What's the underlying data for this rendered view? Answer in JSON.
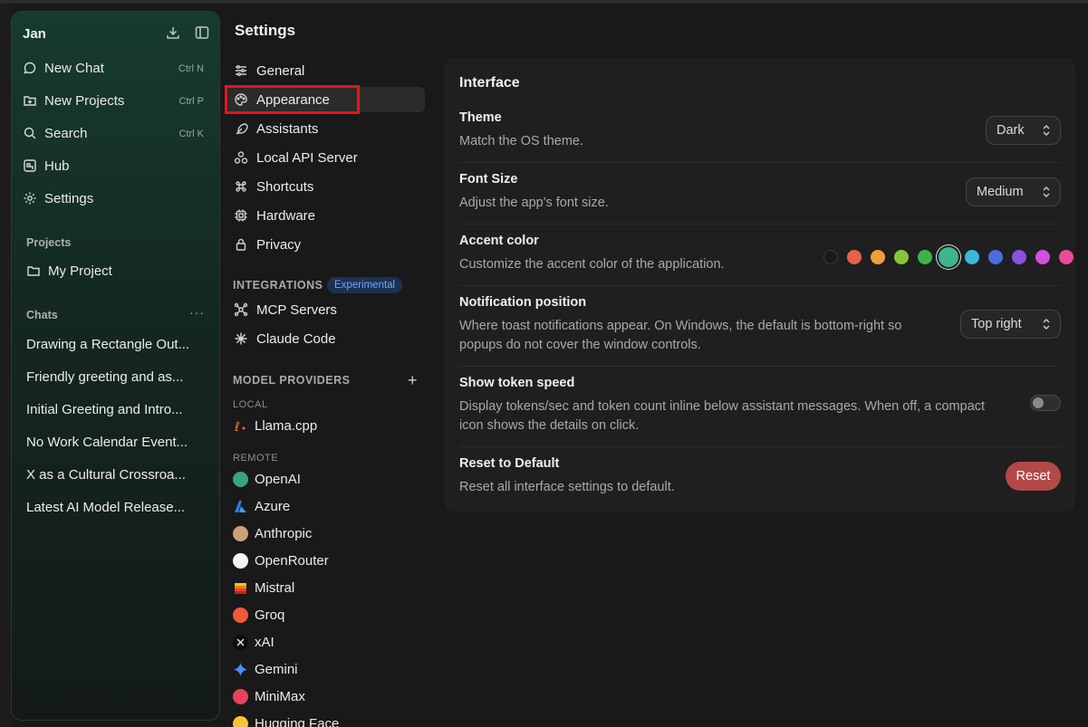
{
  "sidebar": {
    "title": "Jan",
    "nav": [
      {
        "label": "New Chat",
        "shortcut": "Ctrl N",
        "icon": "chat-bubble-icon"
      },
      {
        "label": "New Projects",
        "shortcut": "Ctrl P",
        "icon": "folder-plus-icon"
      },
      {
        "label": "Search",
        "shortcut": "Ctrl K",
        "icon": "search-icon"
      },
      {
        "label": "Hub",
        "shortcut": "",
        "icon": "hub-icon"
      },
      {
        "label": "Settings",
        "shortcut": "",
        "icon": "gear-icon"
      }
    ],
    "projects_label": "Projects",
    "projects": [
      {
        "label": "My Project",
        "icon": "folder-icon"
      }
    ],
    "chats_label": "Chats",
    "chats_more": "···",
    "chats": [
      "Drawing a Rectangle Out...",
      "Friendly greeting and as...",
      "Initial Greeting and Intro...",
      "No Work Calendar Event...",
      "X as a Cultural Crossroa...",
      "Latest AI Model Release..."
    ]
  },
  "settings": {
    "title": "Settings",
    "menu": [
      {
        "label": "General",
        "icon": "sliders-icon"
      },
      {
        "label": "Appearance",
        "icon": "palette-icon",
        "active": true
      },
      {
        "label": "Assistants",
        "icon": "feather-icon"
      },
      {
        "label": "Local API Server",
        "icon": "server-icon"
      },
      {
        "label": "Shortcuts",
        "icon": "command-icon"
      },
      {
        "label": "Hardware",
        "icon": "cpu-icon"
      },
      {
        "label": "Privacy",
        "icon": "lock-icon"
      }
    ],
    "integrations_label": "INTEGRATIONS",
    "experimental_badge": "Experimental",
    "integrations": [
      {
        "label": "MCP Servers",
        "icon": "mcp-icon"
      },
      {
        "label": "Claude Code",
        "icon": "claude-icon"
      }
    ],
    "model_providers_label": "MODEL PROVIDERS",
    "add_provider": "+",
    "local_label": "LOCAL",
    "local_providers": [
      {
        "label": "Llama.cpp",
        "color": "#e8763a"
      }
    ],
    "remote_label": "REMOTE",
    "remote_providers": [
      {
        "label": "OpenAI",
        "color": "#3aa37f"
      },
      {
        "label": "Azure",
        "color": "#2a7ae2"
      },
      {
        "label": "Anthropic",
        "color": "#c9a27a"
      },
      {
        "label": "OpenRouter",
        "color": "#f4f4f4"
      },
      {
        "label": "Mistral",
        "color": "#f17c1e"
      },
      {
        "label": "Groq",
        "color": "#f05a3a"
      },
      {
        "label": "xAI",
        "color": "#0d0d0d"
      },
      {
        "label": "Gemini",
        "color": "#4b8df8"
      },
      {
        "label": "MiniMax",
        "color": "#e8435a"
      },
      {
        "label": "Hugging Face",
        "color": "#f8c434"
      }
    ]
  },
  "interface": {
    "title": "Interface",
    "theme": {
      "title": "Theme",
      "desc": "Match the OS theme.",
      "value": "Dark"
    },
    "font_size": {
      "title": "Font Size",
      "desc": "Adjust the app's font size.",
      "value": "Medium"
    },
    "accent": {
      "title": "Accent color",
      "desc": "Customize the accent color of the application.",
      "colors": [
        "#1a1a1a",
        "#e8604c",
        "#f0a03a",
        "#8ac43c",
        "#3cb44b",
        "#3eb58e",
        "#3ab7e0",
        "#4a6ee0",
        "#8a52e0",
        "#d24fe0",
        "#ec4b9a"
      ],
      "selected_index": 5
    },
    "notification": {
      "title": "Notification position",
      "desc1": "Where toast notifications appear. On Windows, the default is bottom-right so",
      "desc2": "popups do not cover the window controls.",
      "value": "Top right"
    },
    "token_speed": {
      "title": "Show token speed",
      "desc1": "Display tokens/sec and token count inline below assistant messages. When off, a compact",
      "desc2": "icon shows the details on click.",
      "enabled": false
    },
    "reset": {
      "title": "Reset to Default",
      "desc": "Reset all interface settings to default.",
      "button": "Reset"
    }
  }
}
